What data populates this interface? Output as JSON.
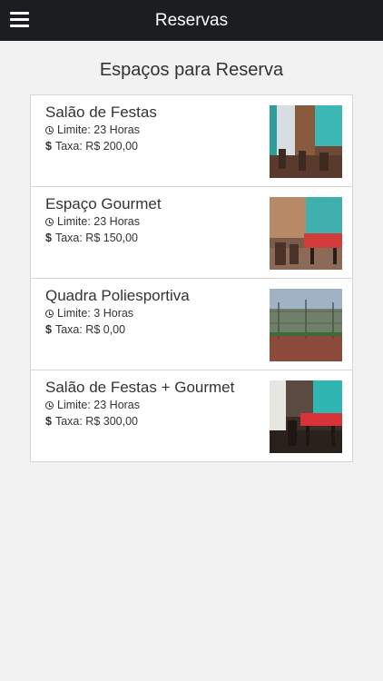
{
  "header": {
    "title": "Reservas",
    "menu_icon": "hamburger-menu-icon"
  },
  "main": {
    "title": "Espaços para Reserva",
    "items": [
      {
        "name": "Salão de Festas",
        "limit": "Limite: 23 Horas",
        "fee": "Taxa: R$ 200,00",
        "fee_symbol": "$"
      },
      {
        "name": "Espaço Gourmet",
        "limit": "Limite: 23 Horas",
        "fee": "Taxa: R$ 150,00",
        "fee_symbol": "$"
      },
      {
        "name": "Quadra Poliesportiva",
        "limit": "Limite: 3 Horas",
        "fee": "Taxa: R$ 0,00",
        "fee_symbol": "$"
      },
      {
        "name": "Salão de Festas + Gourmet",
        "limit": "Limite: 23 Horas",
        "fee": "Taxa: R$ 300,00",
        "fee_symbol": "$"
      }
    ]
  },
  "colors": {
    "header_bg": "#1b1d20",
    "page_bg": "#f2f2f2",
    "card_bg": "#ffffff"
  }
}
